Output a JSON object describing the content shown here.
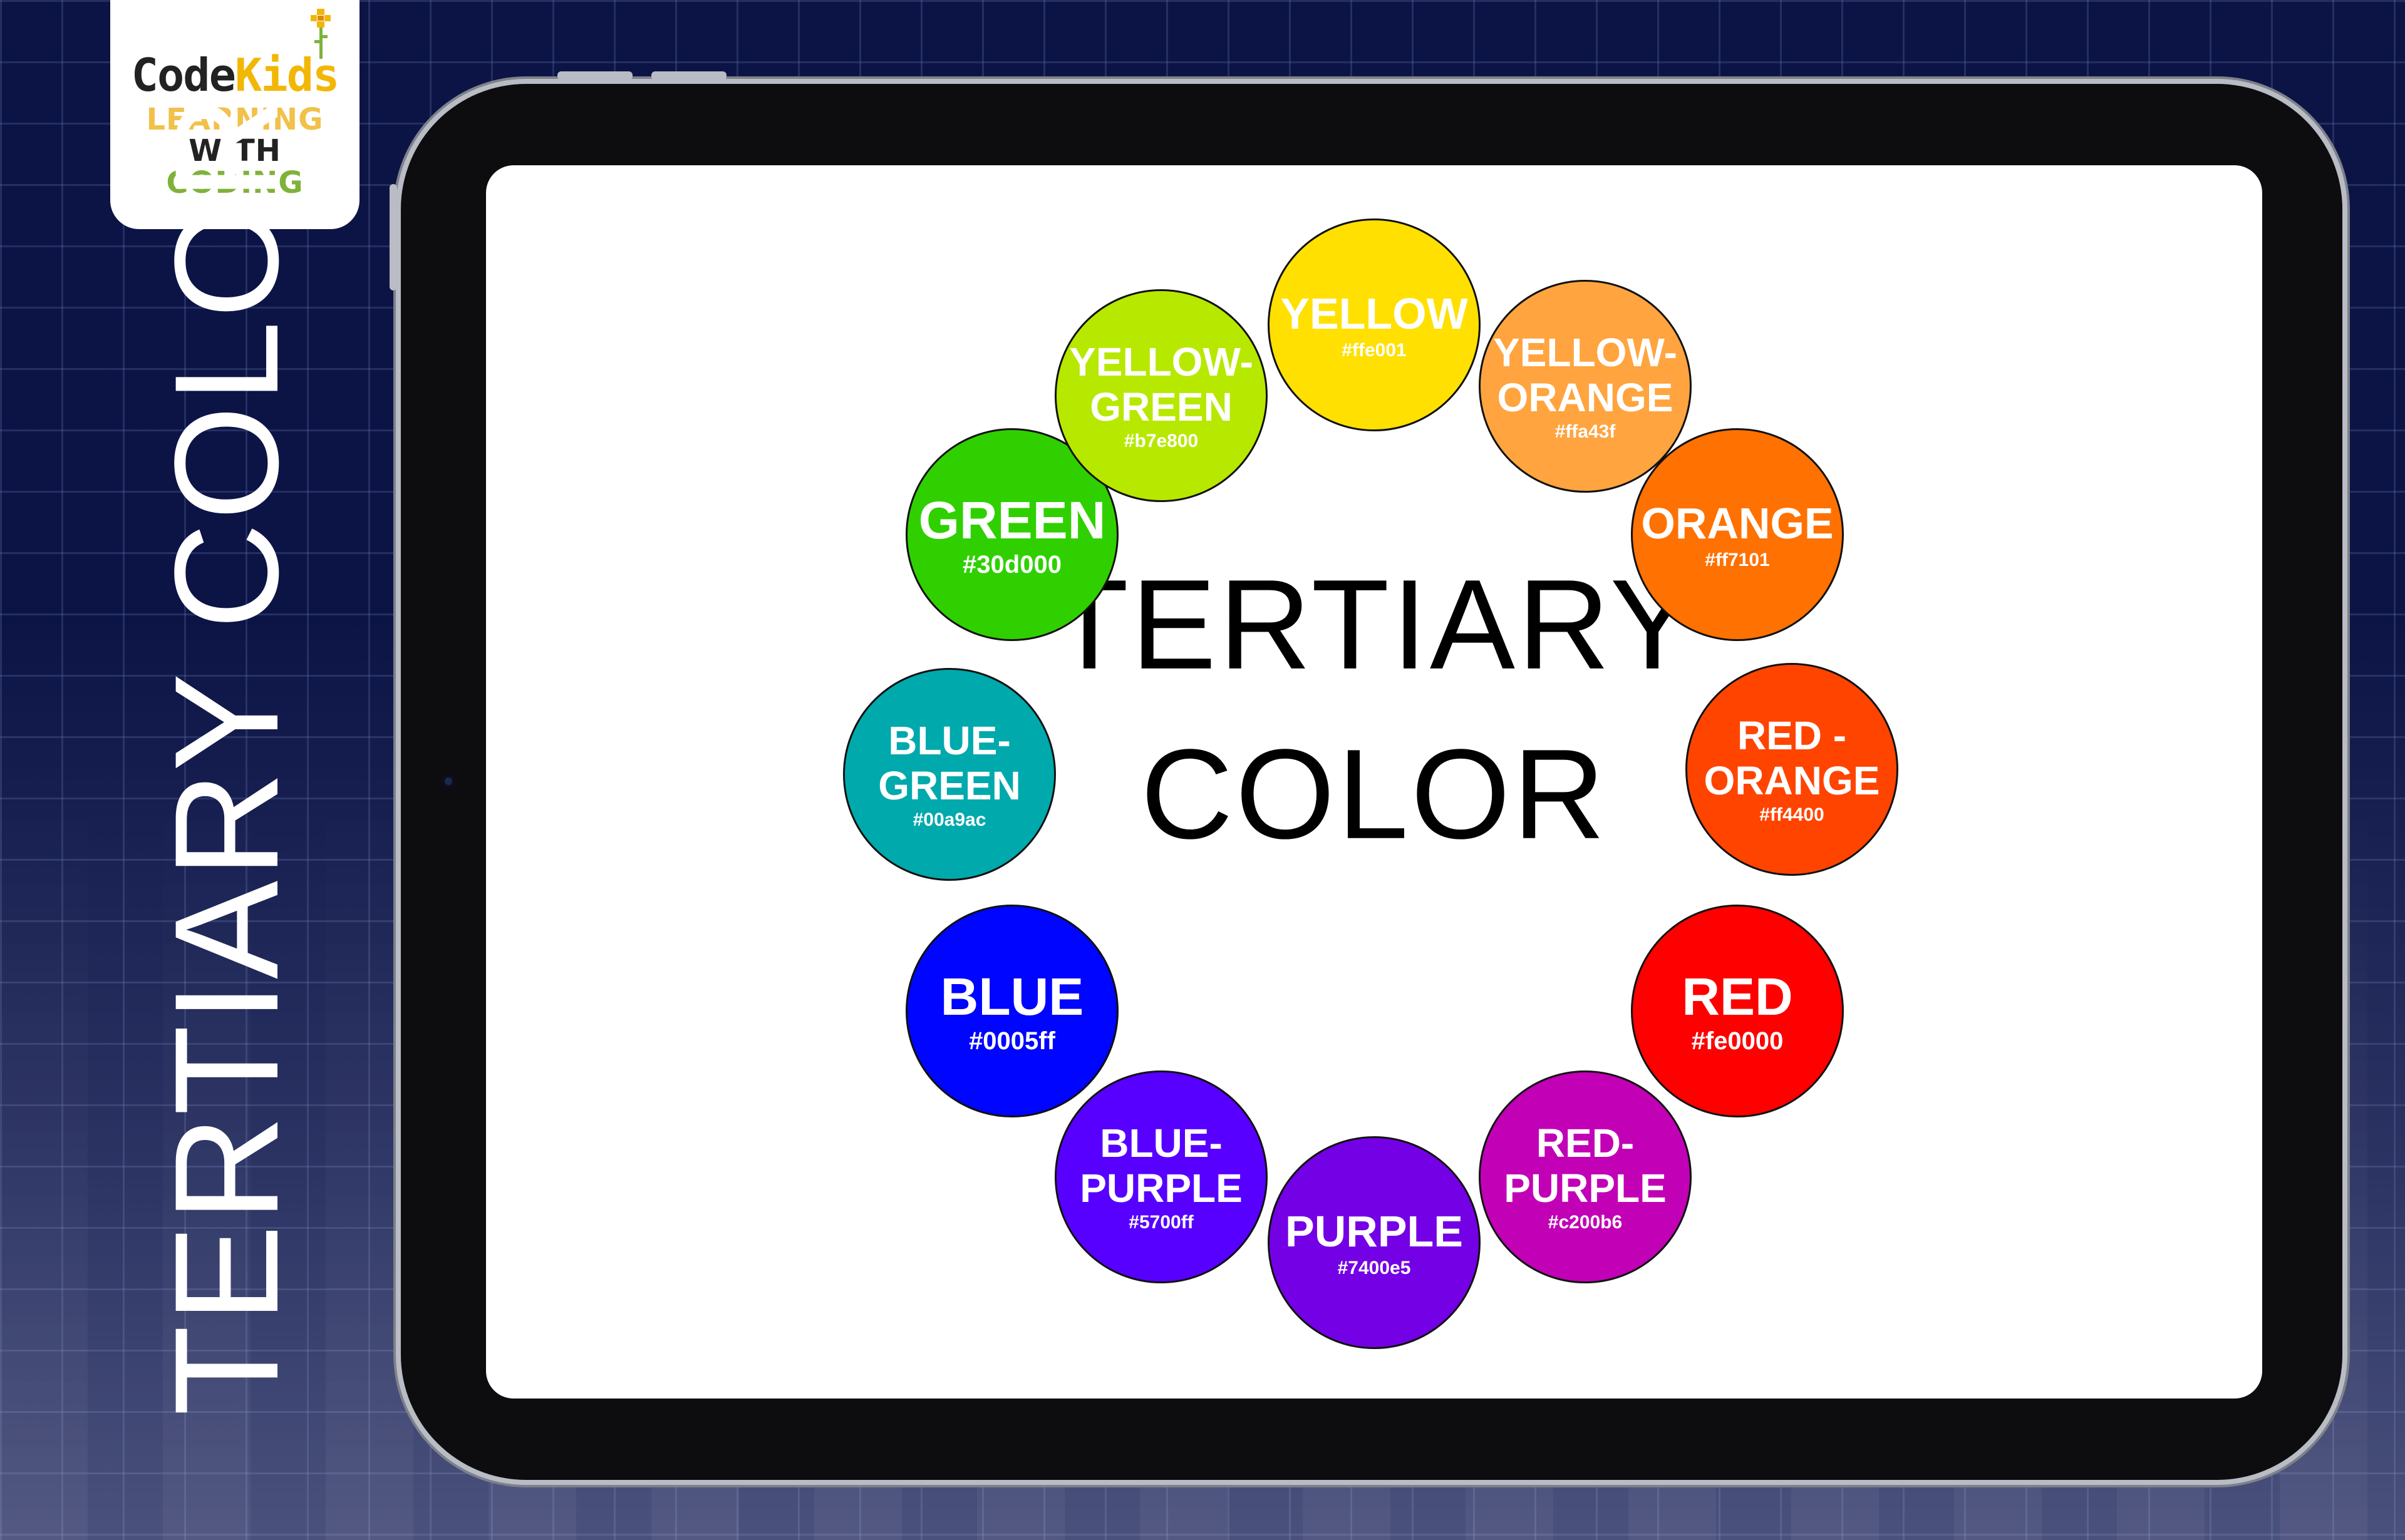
{
  "logo": {
    "brand_main": "Code",
    "brand_accent": "Kids",
    "line1": "LEARNING",
    "line2": "WITH",
    "line3": "CODING"
  },
  "side_title": "TERTIARY  COLOR",
  "center_title": {
    "line1": "TERTIARY",
    "line2": "COLOR"
  },
  "colors": [
    {
      "id": "yellow",
      "lines": [
        "YELLOW"
      ],
      "hex": "#ffe001",
      "color": "#ffe001"
    },
    {
      "id": "yellow-orange",
      "lines": [
        "YELLOW-",
        "ORANGE"
      ],
      "hex": "#ffa43f",
      "color": "#ffa43f"
    },
    {
      "id": "orange",
      "lines": [
        "ORANGE"
      ],
      "hex": "#ff7101",
      "color": "#ff7101"
    },
    {
      "id": "red-orange",
      "lines": [
        "RED -",
        "ORANGE"
      ],
      "hex": "#ff4400",
      "color": "#ff4400"
    },
    {
      "id": "red",
      "lines": [
        "RED"
      ],
      "hex": "#fe0000",
      "color": "#fe0000"
    },
    {
      "id": "red-purple",
      "lines": [
        "RED-",
        "PURPLE"
      ],
      "hex": "#c200b6",
      "color": "#c200b6"
    },
    {
      "id": "purple",
      "lines": [
        "PURPLE"
      ],
      "hex": "#7400e5",
      "color": "#7400e5"
    },
    {
      "id": "blue-purple",
      "lines": [
        "BLUE-",
        "PURPLE"
      ],
      "hex": "#5700ff",
      "color": "#5700ff"
    },
    {
      "id": "blue",
      "lines": [
        "BLUE"
      ],
      "hex": "#0005ff",
      "color": "#0005ff"
    },
    {
      "id": "blue-green",
      "lines": [
        "BLUE-",
        "GREEN"
      ],
      "hex": "#00a9ac",
      "color": "#00a9ac"
    },
    {
      "id": "green",
      "lines": [
        "GREEN"
      ],
      "hex": "#30d000",
      "color": "#30d000"
    },
    {
      "id": "yellow-green",
      "lines": [
        "YELLOW-",
        "GREEN"
      ],
      "hex": "#b7e800",
      "color": "#b7e800"
    }
  ]
}
